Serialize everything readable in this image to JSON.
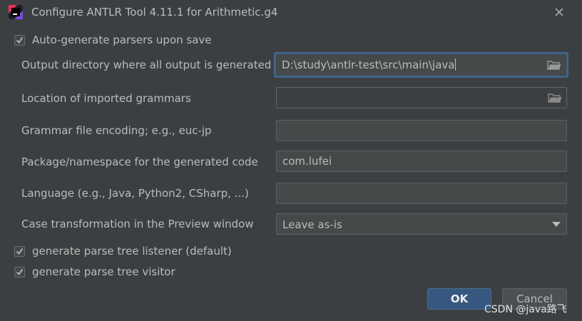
{
  "window": {
    "title": "Configure ANTLR Tool 4.11.1 for Arithmetic.g4",
    "app_icon": "antlr-plugin-icon",
    "close_icon": "close-icon"
  },
  "options": {
    "auto_generate": {
      "label": "Auto-generate parsers upon save",
      "checked": true
    },
    "output_directory": {
      "label": "Output directory where all output is generated",
      "value": "D:\\study\\antlr-test\\src\\main\\java"
    },
    "imported_grammars": {
      "label": "Location of imported grammars",
      "value": ""
    },
    "encoding": {
      "label": "Grammar file encoding; e.g., euc-jp",
      "value": ""
    },
    "package": {
      "label": "Package/namespace for the generated code",
      "value": "com.lufei"
    },
    "language": {
      "label": "Language (e.g., Java, Python2, CSharp, ...)",
      "value": ""
    },
    "case_transformation": {
      "label": "Case transformation in the Preview window",
      "selected": "Leave as-is"
    },
    "listener": {
      "label": "generate parse tree listener (default)",
      "checked": true
    },
    "visitor": {
      "label": "generate parse tree visitor",
      "checked": true
    }
  },
  "buttons": {
    "ok": "OK",
    "cancel": "Cancel"
  },
  "watermark": "CSDN @java路飞",
  "colors": {
    "background": "#3c3f41",
    "focus_border": "#3d6185",
    "primary_button": "#365880"
  }
}
